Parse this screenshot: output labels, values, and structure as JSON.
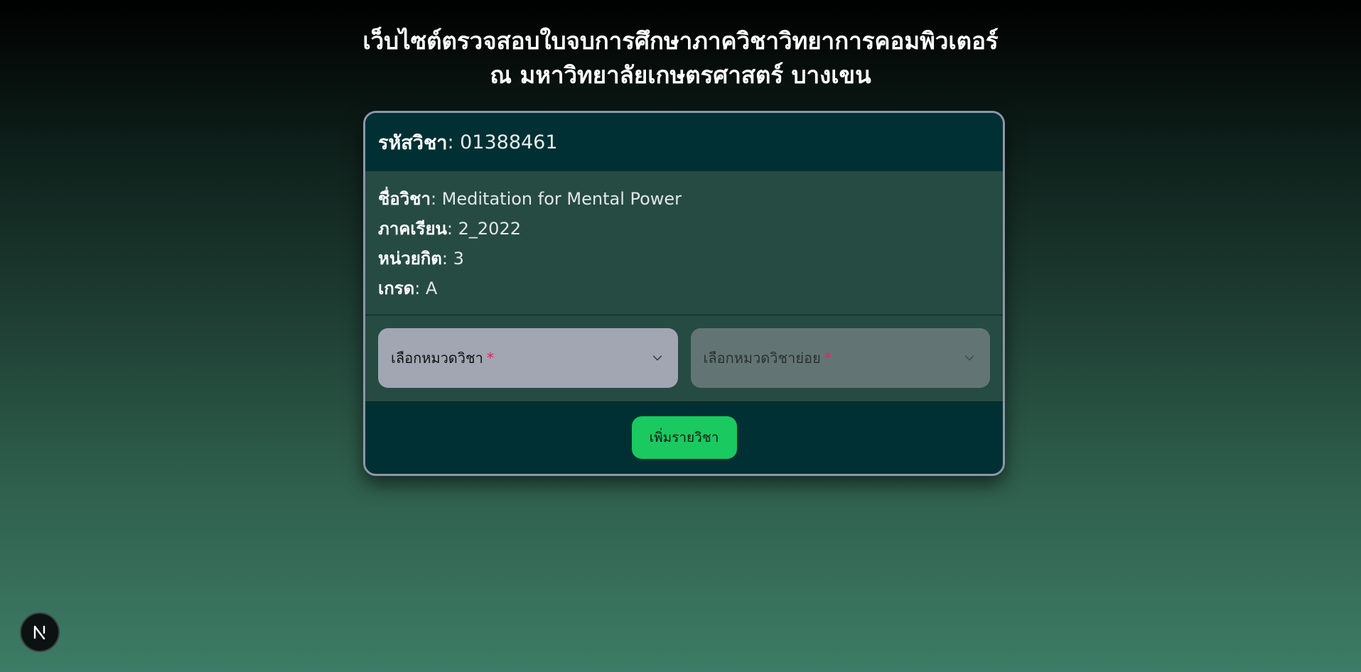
{
  "page": {
    "title_line1": "เว็บไซต์ตรวจสอบใบจบการศึกษาภาควิชาวิทยาการคอมพิวเตอร์",
    "title_line2": "ณ มหาวิทยาลัยเกษตรศาสตร์ บางเขน"
  },
  "course": {
    "code_label": "รหัสวิชา",
    "code_value": ": 01388461",
    "name_label": "ชื่อวิชา",
    "name_value": ": Meditation for Mental Power",
    "semester_label": "ภาคเรียน",
    "semester_value": ": 2_2022",
    "credits_label": "หน่วยกิต",
    "credits_value": ": 3",
    "grade_label": "เกรด",
    "grade_value": ": A"
  },
  "selects": {
    "category_label": "เลือกหมวดวิชา",
    "subcategory_label": "เลือกหมวดวิชาย่อย",
    "required_mark": "*"
  },
  "actions": {
    "add_label": "เพิ่มรายวิชา"
  },
  "colors": {
    "accent_button": "#1ac95f",
    "card_header": "#003033",
    "card_body": "#264b42",
    "required": "#e0245e"
  },
  "icons": {
    "select_arrow": "chevron-down-icon",
    "dev_badge": "nextjs-logo-icon"
  }
}
